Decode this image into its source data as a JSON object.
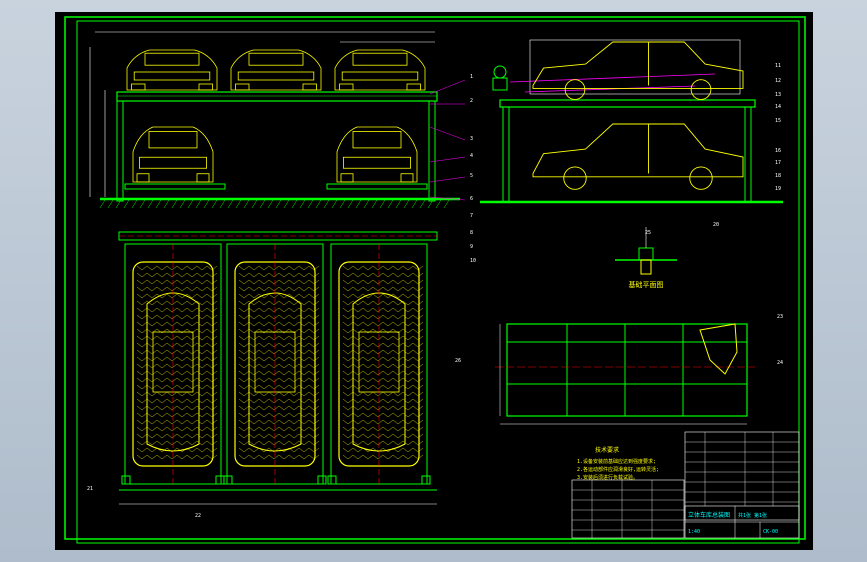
{
  "viewport": {
    "background": "#000000",
    "frame_color": "#00ff00"
  },
  "colors": {
    "frame": "#00ff00",
    "structure": "#00ff00",
    "car": "#ffff00",
    "dimension": "#ffffff",
    "hatch": "#ffff00",
    "centerline": "#ff0000",
    "hydraulic": "#ff00ff",
    "leader": "#00ffff",
    "cyan_text": "#00ffff"
  },
  "views": {
    "front_elevation": {
      "name": "front-elevation-view"
    },
    "side_elevation": {
      "name": "side-elevation-view"
    },
    "plan_view": {
      "name": "plan-view"
    },
    "detail_foundation": {
      "name": "foundation-detail",
      "label": "基础平面图"
    },
    "pit_plan": {
      "name": "pit-plan-view"
    }
  },
  "part_numbers": [
    "1",
    "2",
    "3",
    "4",
    "5",
    "6",
    "7",
    "8",
    "9",
    "10",
    "11",
    "12",
    "13",
    "14",
    "15",
    "16",
    "17",
    "18",
    "19",
    "20",
    "21",
    "22",
    "23",
    "24",
    "25",
    "26"
  ],
  "notes": {
    "heading": "技术要求",
    "lines": [
      "1.设备安装前基础应达到强度要求;",
      "2.各运动部件应润滑良好,运转灵活;",
      "3.安装后须进行负载试验。"
    ]
  },
  "title_block": {
    "title": "立体车库总装图",
    "drawing_no": "CK-00",
    "scale": "1:40",
    "sheet": "共1张 第1张"
  }
}
